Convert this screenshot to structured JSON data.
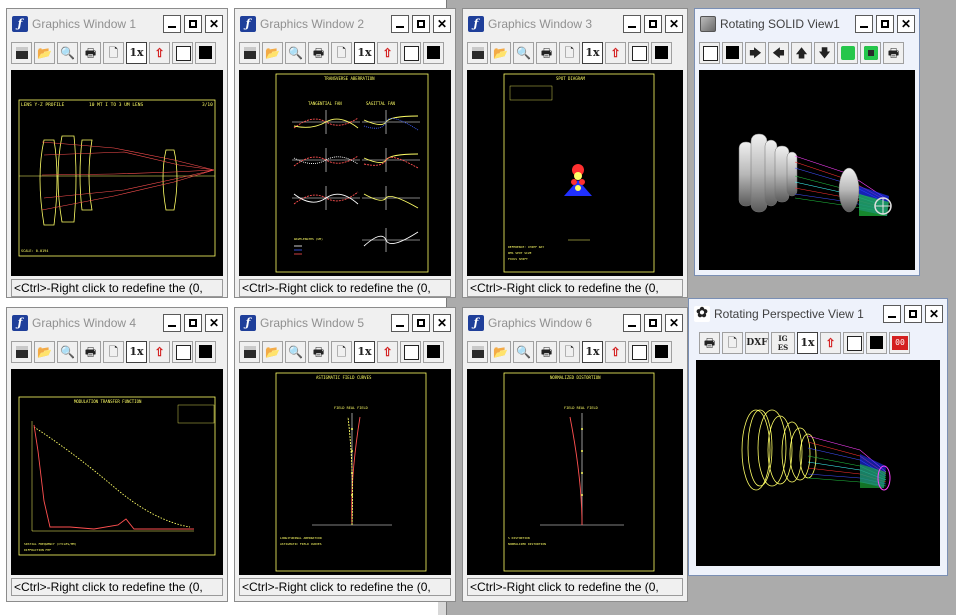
{
  "status_text": "<Ctrl>-Right click to redefine the (0,",
  "windows": {
    "gw1": {
      "title": "Graphics Window 1",
      "chart_title": "LENS Y-Z PROFILE",
      "caption": "10 MT I TO 3 UM LENS",
      "label_right": "3/10"
    },
    "gw2": {
      "title": "Graphics Window 2",
      "chart_title": "TRANSVERSE ABERRATION",
      "left_head": "TANGENTIAL FAN",
      "right_head": "SAGITTAL FAN"
    },
    "gw3": {
      "title": "Graphics Window 3",
      "chart_title": "SPOT DIAGRAM"
    },
    "solid": {
      "title": "Rotating SOLID View1"
    },
    "gw4": {
      "title": "Graphics Window 4",
      "chart_title": "MODULATION TRANSFER FUNCTION"
    },
    "gw5": {
      "title": "Graphics Window 5",
      "chart_title": "ASTIGMATIC FIELD CURVES",
      "sub": "FIELD REAL FIELD"
    },
    "gw6": {
      "title": "Graphics Window 6",
      "chart_title": "NORMALIZED DISTORTION",
      "sub": "FIELD REAL FIELD"
    },
    "persp": {
      "title": "Rotating Perspective View 1"
    }
  },
  "toolbar_graphics": [
    {
      "name": "save-icon",
      "label": ""
    },
    {
      "name": "open-folder-icon",
      "label": "📂"
    },
    {
      "name": "zoom-icon",
      "label": "🔍"
    },
    {
      "name": "print-icon",
      "label": "🖶"
    },
    {
      "name": "preview-icon",
      "label": "🗋"
    },
    {
      "name": "scale-1x-icon",
      "label": "1x"
    },
    {
      "name": "redraw-icon",
      "label": "⇧"
    }
  ],
  "toolbar_solid_arrows": [
    "🡆",
    "🡄",
    "🡅",
    "🡇"
  ],
  "toolbar_persp": {
    "dxf": "DXF",
    "iges": "IG ES",
    "scale": "1x"
  },
  "colors": {
    "accent_title_icon": "#1f3f9a",
    "plot_yellow": "#ffff66",
    "plot_red": "#ff4040"
  }
}
